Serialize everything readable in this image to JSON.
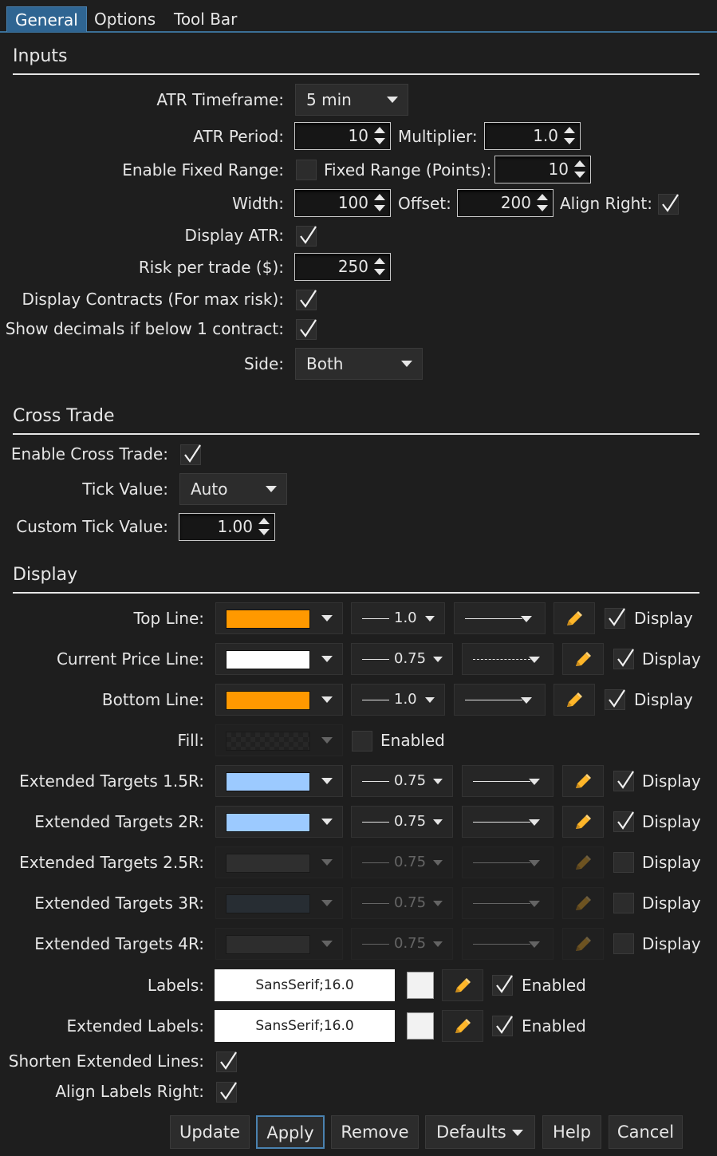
{
  "tabs": [
    "General",
    "Options",
    "Tool Bar"
  ],
  "inputs": {
    "title": "Inputs",
    "atr_timeframe_label": "ATR Timeframe:",
    "atr_timeframe_value": "5 min",
    "atr_period_label": "ATR Period:",
    "atr_period_value": "10",
    "multiplier_label": "Multiplier:",
    "multiplier_value": "1.0",
    "enable_fixed_range_label": "Enable Fixed Range:",
    "enable_fixed_range_checked": false,
    "fixed_range_label": "Fixed Range (Points):",
    "fixed_range_value": "10",
    "width_label": "Width:",
    "width_value": "100",
    "offset_label": "Offset:",
    "offset_value": "200",
    "align_right_label": "Align Right:",
    "align_right_checked": true,
    "display_atr_label": "Display ATR:",
    "display_atr_checked": true,
    "risk_label": "Risk per trade ($):",
    "risk_value": "250",
    "display_contracts_label": "Display Contracts (For max risk):",
    "display_contracts_checked": true,
    "show_decimals_label": "Show decimals if below 1 contract:",
    "show_decimals_checked": true,
    "side_label": "Side:",
    "side_value": "Both"
  },
  "cross_trade": {
    "title": "Cross Trade",
    "enable_label": "Enable Cross Trade:",
    "enable_checked": true,
    "tick_value_label": "Tick Value:",
    "tick_value_value": "Auto",
    "custom_tick_label": "Custom Tick Value:",
    "custom_tick_value": "1.00"
  },
  "display": {
    "title": "Display",
    "lines": [
      {
        "label": "Top Line:",
        "color": "#ff9900",
        "width": "1.0",
        "style": "solid",
        "display_label": "Display",
        "checked": true,
        "enabled": true
      },
      {
        "label": "Current Price Line:",
        "color": "#ffffff",
        "width": "0.75",
        "style": "dashed",
        "display_label": "Display",
        "checked": true,
        "enabled": true
      },
      {
        "label": "Bottom Line:",
        "color": "#ff9900",
        "width": "1.0",
        "style": "solid",
        "display_label": "Display",
        "checked": true,
        "enabled": true
      },
      {
        "label": "Extended Targets 1.5R:",
        "color": "#9ccaff",
        "width": "0.75",
        "style": "solid",
        "display_label": "Display",
        "checked": true,
        "enabled": true
      },
      {
        "label": "Extended Targets 2R:",
        "color": "#9ccaff",
        "width": "0.75",
        "style": "solid",
        "display_label": "Display",
        "checked": true,
        "enabled": true
      },
      {
        "label": "Extended Targets 2.5R:",
        "color": "#505050",
        "width": "0.75",
        "style": "solid",
        "display_label": "Display",
        "checked": false,
        "enabled": false
      },
      {
        "label": "Extended Targets 3R:",
        "color": "#3a4a5a",
        "width": "0.75",
        "style": "solid",
        "display_label": "Display",
        "checked": false,
        "enabled": false
      },
      {
        "label": "Extended Targets 4R:",
        "color": "#4a4a4a",
        "width": "0.75",
        "style": "solid",
        "display_label": "Display",
        "checked": false,
        "enabled": false
      }
    ],
    "fill_label": "Fill:",
    "fill_enabled_label": "Enabled",
    "fill_checked": false,
    "labels_label": "Labels:",
    "labels_font": "SansSerif;16.0",
    "labels_enabled_label": "Enabled",
    "labels_checked": true,
    "ext_labels_label": "Extended Labels:",
    "ext_labels_font": "SansSerif;16.0",
    "ext_labels_enabled_label": "Enabled",
    "ext_labels_checked": true,
    "shorten_label": "Shorten Extended Lines:",
    "shorten_checked": true,
    "align_labels_label": "Align Labels Right:",
    "align_labels_checked": true
  },
  "buttons": {
    "update": "Update",
    "apply": "Apply",
    "remove": "Remove",
    "defaults": "Defaults",
    "help": "Help",
    "cancel": "Cancel"
  }
}
